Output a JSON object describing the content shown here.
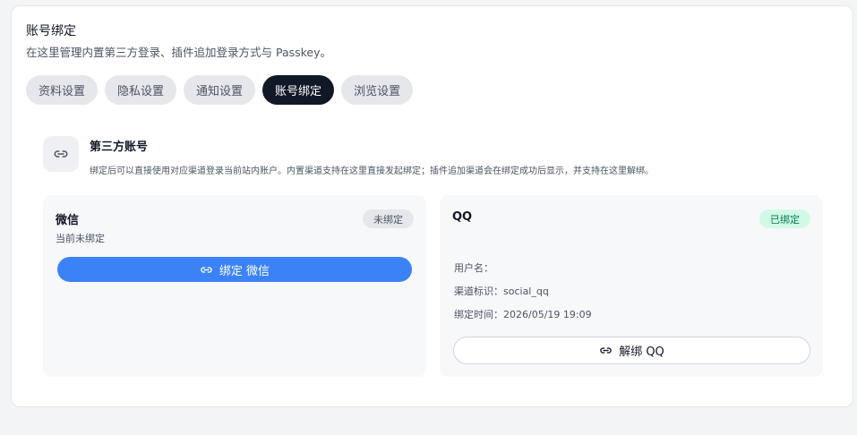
{
  "header": {
    "title": "账号绑定",
    "subtitle": "在这里管理内置第三方登录、插件追加登录方式与 Passkey。"
  },
  "tabs": [
    {
      "label": "资料设置"
    },
    {
      "label": "隐私设置"
    },
    {
      "label": "通知设置"
    },
    {
      "label": "账号绑定"
    },
    {
      "label": "浏览设置"
    }
  ],
  "active_tab": "账号绑定",
  "section": {
    "icon": "link-icon",
    "title": "第三方账号",
    "description": "绑定后可以直接使用对应渠道登录当前站内账户。内置渠道支持在这里直接发起绑定；插件追加渠道会在绑定成功后显示，并支持在这里解绑。"
  },
  "accounts": {
    "wechat": {
      "name": "微信",
      "badge": "未绑定",
      "status": "当前未绑定",
      "button": "绑定 微信"
    },
    "qq": {
      "name": "QQ",
      "badge": "已绑定",
      "username_label": "用户名：",
      "channel_label": "渠道标识：social_qq",
      "bind_time_label": "绑定时间：2026/05/19 19:09",
      "button": "解绑 QQ"
    }
  },
  "colors": {
    "primary": "#3b82f6",
    "active_tab": "#111827",
    "bound_badge_bg": "#d1fae5",
    "bound_badge_text": "#047857"
  }
}
